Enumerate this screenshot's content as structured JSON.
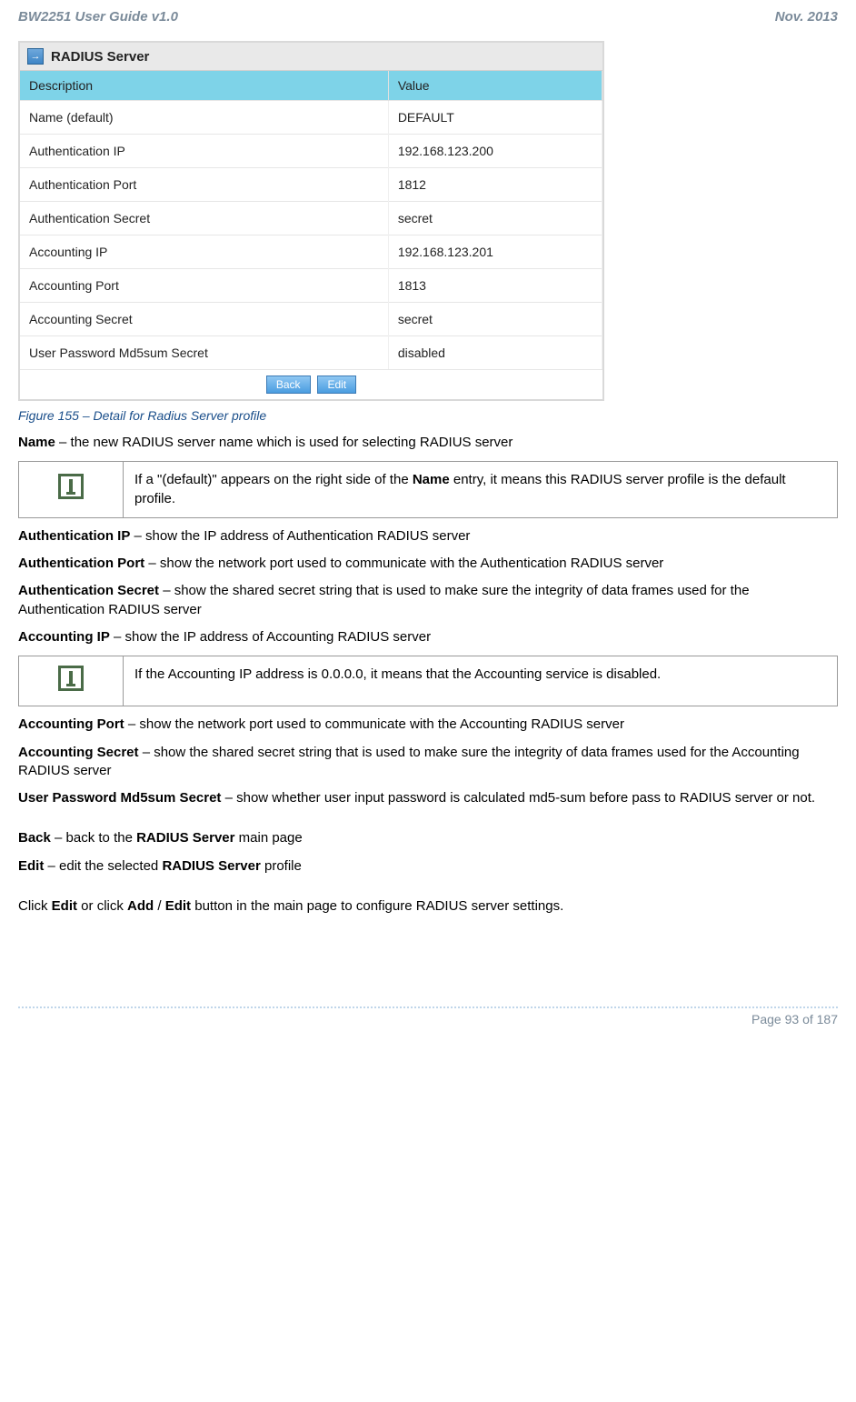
{
  "header": {
    "left": "BW2251 User Guide v1.0",
    "right": "Nov.  2013"
  },
  "panel": {
    "title": "RADIUS Server",
    "columns": {
      "desc": "Description",
      "value": "Value"
    },
    "rows": [
      {
        "desc": "Name   (default)",
        "value": "DEFAULT"
      },
      {
        "desc": "Authentication IP",
        "value": "192.168.123.200"
      },
      {
        "desc": "Authentication Port",
        "value": "1812"
      },
      {
        "desc": "Authentication Secret",
        "value": "secret"
      },
      {
        "desc": "Accounting IP",
        "value": "192.168.123.201"
      },
      {
        "desc": "Accounting Port",
        "value": "1813"
      },
      {
        "desc": "Accounting Secret",
        "value": "secret"
      },
      {
        "desc": "User Password Md5sum Secret",
        "value": "disabled"
      }
    ],
    "buttons": {
      "back": "Back",
      "edit": "Edit"
    }
  },
  "caption": "Figure 155 – Detail for Radius Server profile",
  "text": {
    "name_label": "Name",
    "name_body": " – the new RADIUS server name which is used for selecting RADIUS server",
    "info1_a": "If a \"(default)\" appears on the right side of the ",
    "info1_b": "Name",
    "info1_c": " entry, it means this RADIUS server profile is the default profile.",
    "auth_ip_label": "Authentication IP",
    "auth_ip_body": " – show the IP address of Authentication RADIUS server",
    "auth_port_label": "Authentication Port",
    "auth_port_body": " – show the network port used to communicate with the Authentication RADIUS server",
    "auth_secret_label": "Authentication Secret",
    "auth_secret_body": " – show the shared secret string that is used to make sure the integrity of data frames used for the Authentication RADIUS server",
    "acct_ip_label": "Accounting IP",
    "acct_ip_body": " – show the IP address of Accounting RADIUS server",
    "info2": "If the Accounting IP address is 0.0.0.0, it means that the Accounting service is disabled.",
    "acct_port_label": "Accounting Port",
    "acct_port_body": " – show the network port used to communicate with the Accounting RADIUS server",
    "acct_secret_label": "Accounting Secret",
    "acct_secret_body": " – show the shared secret string that is used to make sure the integrity of data frames used for the Accounting RADIUS server",
    "md5_label": "User Password Md5sum Secret",
    "md5_body": " – show whether user input password is calculated md5-sum before pass to RADIUS server or not.",
    "back_label": "Back",
    "back_mid": " – back to the ",
    "back_b": "RADIUS Server",
    "back_end": " main page",
    "edit_label": "Edit",
    "edit_mid": " – edit the selected ",
    "edit_b": "RADIUS Server",
    "edit_end": " profile",
    "click_a": "Click ",
    "click_b": "Edit",
    "click_c": " or click ",
    "click_d": "Add",
    "click_e": " / ",
    "click_f": "Edit",
    "click_g": " button in the main page to configure RADIUS server settings."
  },
  "footer": "Page 93 of 187"
}
